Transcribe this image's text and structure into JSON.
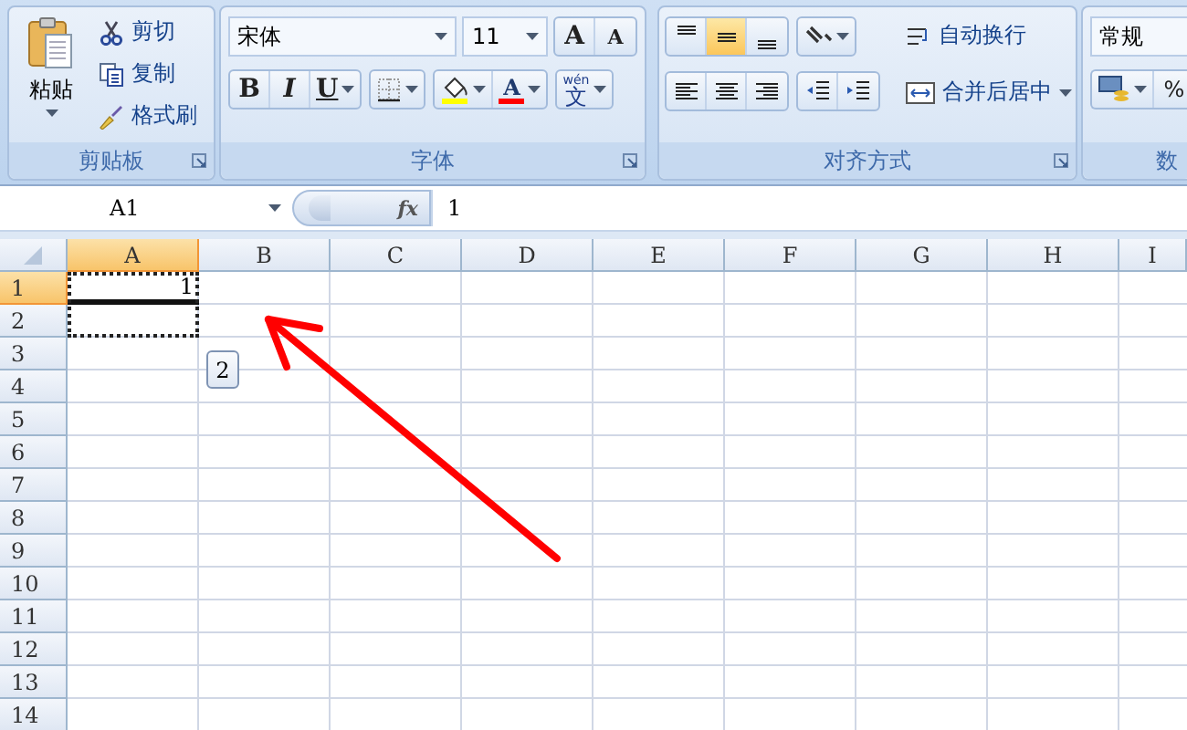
{
  "clipboard": {
    "paste": "粘贴",
    "actions": [
      {
        "kind": "cut",
        "label": "剪切"
      },
      {
        "kind": "copy",
        "label": "复制"
      },
      {
        "kind": "format-painter",
        "label": "格式刷"
      }
    ],
    "title": "剪贴板"
  },
  "font": {
    "name": "宋体",
    "size": "11",
    "grow": "A",
    "shrink": "A",
    "styles": [
      {
        "kind": "bold",
        "label": "B"
      },
      {
        "kind": "italic",
        "label": "I"
      },
      {
        "kind": "underline",
        "label": "U"
      }
    ],
    "font_color": "A",
    "phonetic": {
      "ruby": "wén",
      "label": "文"
    },
    "title": "字体"
  },
  "alignment": {
    "vertical": [
      {
        "kind": "top",
        "selected": false
      },
      {
        "kind": "middle",
        "selected": true
      },
      {
        "kind": "bottom",
        "selected": false
      }
    ],
    "horizontal": [
      {
        "kind": "left",
        "selected": false
      },
      {
        "kind": "center",
        "selected": false
      },
      {
        "kind": "right",
        "selected": false
      }
    ],
    "wrap": "自动换行",
    "merge": "合并后居中",
    "title": "对齐方式"
  },
  "number": {
    "format": "常规",
    "percent": "%",
    "title": "数"
  },
  "formula_bar": {
    "name_box": "A1",
    "fx": "fx",
    "value": "1"
  },
  "sheet": {
    "columns": [
      {
        "label": "A",
        "selected": true
      },
      {
        "label": "B",
        "selected": false
      },
      {
        "label": "C",
        "selected": false
      },
      {
        "label": "D",
        "selected": false
      },
      {
        "label": "E",
        "selected": false
      },
      {
        "label": "F",
        "selected": false
      },
      {
        "label": "G",
        "selected": false
      },
      {
        "label": "H",
        "selected": false
      },
      {
        "label": "I",
        "selected": false
      }
    ],
    "rows": [
      {
        "label": "1",
        "selected": true,
        "cells": [
          "1"
        ]
      },
      {
        "label": "2",
        "selected": false
      },
      {
        "label": "3",
        "selected": false
      },
      {
        "label": "4",
        "selected": false
      },
      {
        "label": "5",
        "selected": false
      },
      {
        "label": "6",
        "selected": false
      },
      {
        "label": "7",
        "selected": false
      },
      {
        "label": "8",
        "selected": false
      },
      {
        "label": "9",
        "selected": false
      },
      {
        "label": "10",
        "selected": false
      },
      {
        "label": "11",
        "selected": false
      },
      {
        "label": "12",
        "selected": false
      },
      {
        "label": "13",
        "selected": false
      },
      {
        "label": "14",
        "selected": false
      }
    ],
    "fill_tooltip": "2"
  }
}
